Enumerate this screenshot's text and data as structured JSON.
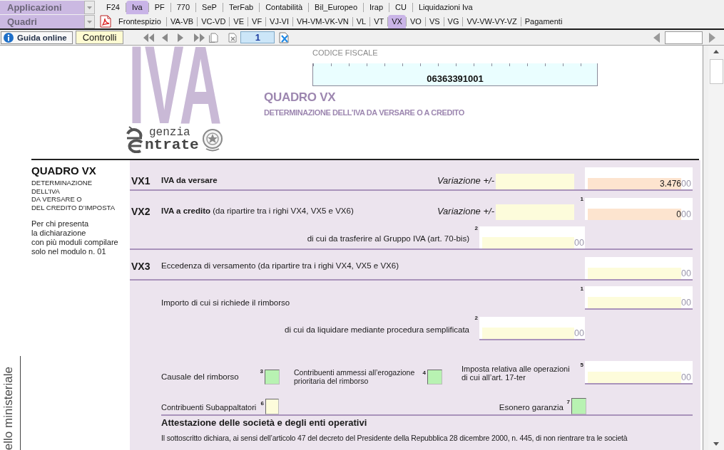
{
  "menus": {
    "applications": {
      "label": "Applicazioni"
    },
    "sections": {
      "label": "Quadri"
    }
  },
  "app_tabs": [
    {
      "label": "F24",
      "selected": false
    },
    {
      "label": "Iva",
      "selected": true
    },
    {
      "label": "PF",
      "selected": false
    },
    {
      "label": "770",
      "selected": false
    },
    {
      "label": "SeP",
      "selected": false
    },
    {
      "label": "TerFab",
      "selected": false
    },
    {
      "label": "Contabilità",
      "selected": false
    },
    {
      "label": "Bil_Europeo",
      "selected": false
    },
    {
      "label": "Irap",
      "selected": false
    },
    {
      "label": "CU",
      "selected": false
    },
    {
      "label": "Liquidazioni Iva",
      "selected": false
    }
  ],
  "section_tabs": [
    {
      "label": "Frontespizio",
      "selected": false
    },
    {
      "label": "VA-VB",
      "selected": false
    },
    {
      "label": "VC-VD",
      "selected": false
    },
    {
      "label": "VE",
      "selected": false
    },
    {
      "label": "VF",
      "selected": false
    },
    {
      "label": "VJ-VI",
      "selected": false
    },
    {
      "label": "VH-VM-VK-VN",
      "selected": false
    },
    {
      "label": "VL",
      "selected": false
    },
    {
      "label": "VT",
      "selected": false
    },
    {
      "label": "VX",
      "selected": true
    },
    {
      "label": "VO",
      "selected": false
    },
    {
      "label": "VS",
      "selected": false
    },
    {
      "label": "VG",
      "selected": false
    },
    {
      "label": "VV-VW-VY-VZ",
      "selected": false
    },
    {
      "label": "Pagamenti",
      "selected": false
    }
  ],
  "toolbar": {
    "help_button": "Guida online",
    "checks_button": "Controlli",
    "page_number": "1"
  },
  "header": {
    "logo": "IVA",
    "agency": {
      "line_1": "genzia",
      "line_2": "ntrate"
    },
    "tax_code": {
      "label": "CODICE FISCALE",
      "value": "06363391001"
    },
    "title": "QUADRO VX",
    "subtitle": "DETERMINAZIONE DELL’IVA DA VERSARE O A CREDITO"
  },
  "sidebar": {
    "title": "QUADRO VX",
    "caption": "DETERMINAZIONE\nDELL’IVA\nDA VERSARE O\nDEL CREDITO D’IMPOSTA",
    "note": "Per chi presenta\nla dichiarazione\ncon più moduli compilare\nsolo nel modulo n. 01",
    "margin_text": "ello ministeriale"
  },
  "rows": [
    {
      "code": "VX1",
      "label": "IVA da versare",
      "strong": true,
      "variation": {
        "label": "Variazione +/-",
        "kind": "input"
      },
      "amount": {
        "kind": "computed",
        "value": "3.476",
        "cents": "00"
      }
    },
    {
      "code": "VX2",
      "label": "**IVA a credito** (da ripartire tra i righi VX4, VX5 e VX6)",
      "strong": false,
      "variation": {
        "label": "Variazione +/-",
        "kind": "input"
      },
      "amount": {
        "number": "1",
        "kind": "computed",
        "value": "0",
        "cents": "00"
      },
      "sub": {
        "label": "di cui da trasferire al Gruppo IVA (art. 70-bis)",
        "number": "2",
        "kind": "input",
        "cents": "00"
      }
    },
    {
      "code": "VX3",
      "label": "Eccedenza di versamento (da ripartire tra i righi VX4, VX5 e VX6)",
      "strong": false,
      "amount": {
        "kind": "input",
        "cents": "00"
      }
    }
  ],
  "refund": {
    "request": {
      "label": "Importo di cui si richiede il rimborso",
      "number": "1",
      "kind": "input",
      "cents": "00"
    },
    "simplified": {
      "label": "di cui da liquidare mediante procedura semplificata",
      "number": "2",
      "kind": "input",
      "cents": "00"
    },
    "reason": {
      "label": "Causale del rimborso",
      "number": "3",
      "kind": "choice"
    },
    "priority": {
      "label": "Contribuenti ammessi all’erogazione\nprioritaria del rimborso",
      "number": "4",
      "kind": "choice"
    },
    "split_payment": {
      "label": "Imposta relativa alle operazioni\ndi cui all’art. 17-ter",
      "number": "5",
      "kind": "input",
      "cents": "00"
    },
    "subcontractors": {
      "label": "Contribuenti Subappaltatori",
      "number": "6",
      "kind": "input"
    },
    "guarantee_exemption": {
      "label": "Esonero garanzia",
      "number": "7",
      "kind": "choice"
    }
  },
  "attestation": {
    "heading": "Attestazione delle società e degli enti operativi",
    "text": "Il sottoscritto dichiara, ai sensi dell’articolo 47 del decreto del Presidente della Repubblica 28 dicembre 2000, n. 445, di non rientrare tra le società"
  }
}
